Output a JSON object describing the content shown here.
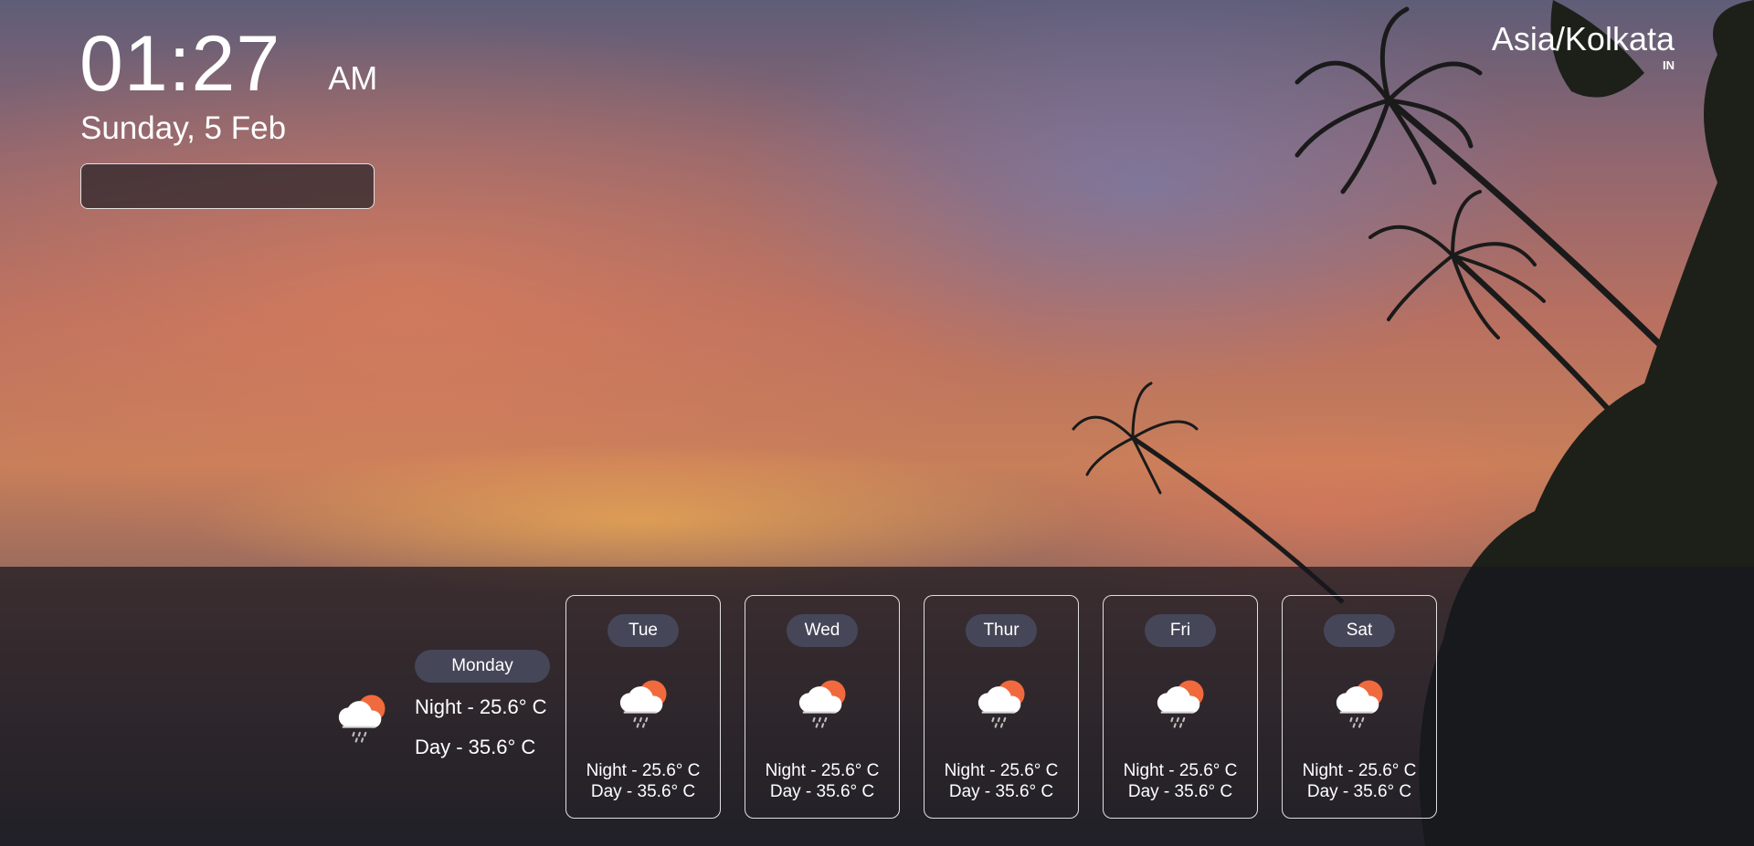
{
  "clock": {
    "time": "01:27",
    "ampm": "AM",
    "date": "Sunday, 5 Feb"
  },
  "search": {
    "value": "",
    "placeholder": ""
  },
  "timezone": {
    "name": "Asia/Kolkata",
    "country": "IN"
  },
  "today": {
    "day": "Monday",
    "night": "Night - 25.6° C",
    "day_temp": "Day - 35.6° C",
    "icon": "cloud-rain-sun-icon"
  },
  "forecast": [
    {
      "day": "Tue",
      "night": "Night - 25.6° C",
      "day_temp": "Day - 35.6° C",
      "icon": "cloud-rain-sun-icon"
    },
    {
      "day": "Wed",
      "night": "Night - 25.6° C",
      "day_temp": "Day - 35.6° C",
      "icon": "cloud-rain-sun-icon"
    },
    {
      "day": "Thur",
      "night": "Night - 25.6° C",
      "day_temp": "Day - 35.6° C",
      "icon": "cloud-rain-sun-icon"
    },
    {
      "day": "Fri",
      "night": "Night - 25.6° C",
      "day_temp": "Day - 35.6° C",
      "icon": "cloud-rain-sun-icon"
    },
    {
      "day": "Sat",
      "night": "Night - 25.6° C",
      "day_temp": "Day - 35.6° C",
      "icon": "cloud-rain-sun-icon"
    }
  ],
  "colors": {
    "panel": "#16161e",
    "pill": "#464a5c",
    "sun": "#f06a3d",
    "cloud": "#ffffff"
  }
}
